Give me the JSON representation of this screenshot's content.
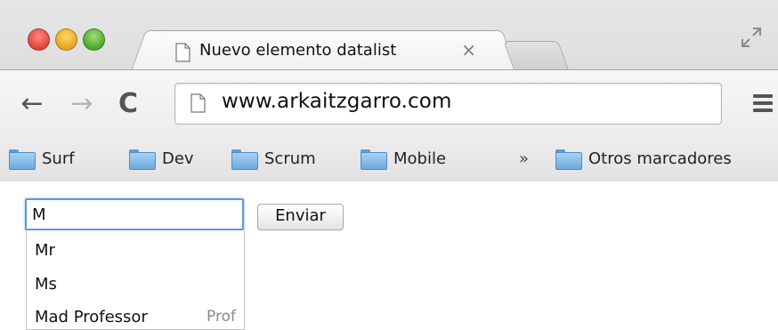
{
  "browser": {
    "tab": {
      "title": "Nuevo elemento datalist",
      "close_label": "×"
    },
    "toolbar": {
      "back_label": "←",
      "forward_label": "→",
      "reload_label": "C",
      "url": "www.arkaitzgarro.com"
    },
    "bookmarks": [
      {
        "label": "Surf"
      },
      {
        "label": "Dev"
      },
      {
        "label": "Scrum"
      },
      {
        "label": "Mobile"
      }
    ],
    "bookmarks_overflow_label": "»",
    "other_bookmarks_label": "Otros marcadores"
  },
  "form": {
    "input_value": "M",
    "submit_label": "Enviar",
    "suggestions": [
      {
        "value": "Mr",
        "label": ""
      },
      {
        "value": "Ms",
        "label": ""
      },
      {
        "value": "Mad Professor",
        "label": "Prof"
      }
    ]
  },
  "colors": {
    "focus_ring": "#5b9ad8",
    "close_button": "#e0443a",
    "minimize_button": "#e5a620",
    "zoom_button": "#4ea72e",
    "folder": "#6aa9dc"
  },
  "icons": [
    "close-window-icon",
    "minimize-window-icon",
    "zoom-window-icon",
    "page-icon",
    "fullscreen-icon",
    "menu-icon",
    "folder-icon"
  ]
}
